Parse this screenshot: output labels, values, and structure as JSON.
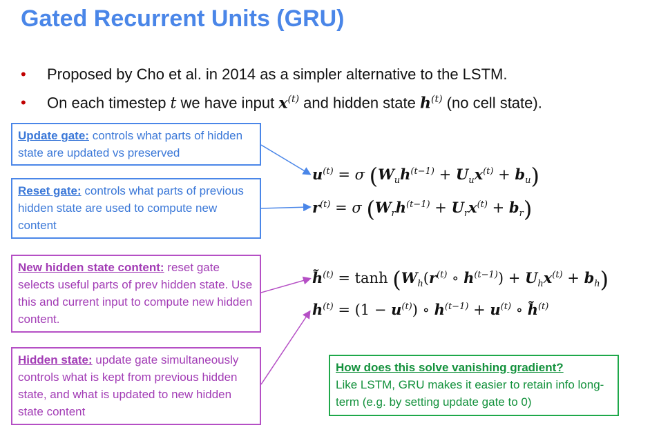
{
  "title": "Gated Recurrent Units (GRU)",
  "bullets": {
    "b1": "Proposed by Cho et al. in 2014 as a simpler alternative to the LSTM.",
    "b2_pre": "On each timestep ",
    "b2_t": "t",
    "b2_mid": " we have input ",
    "b2_mid2": " and hidden state ",
    "b2_post": " (no cell state)."
  },
  "boxes": {
    "update": {
      "heading": "Update gate:",
      "body": " controls what parts of hidden state are updated vs preserved"
    },
    "reset": {
      "heading": "Reset gate:",
      "body": " controls what parts of previous hidden state are used to compute new content"
    },
    "newcontent": {
      "heading": "New hidden state content:",
      "body": " reset gate selects useful parts of prev hidden state. Use this and current input to compute new hidden content."
    },
    "hidden": {
      "heading": "Hidden state:",
      "body": " update gate simultaneously controls what is kept from previous hidden state, and what is updated to new hidden state content"
    },
    "vanishing": {
      "heading": "How does this solve vanishing gradient?",
      "body": "Like LSTM, GRU makes it easier to retain info long-term (e.g. by setting update gate to 0)"
    }
  },
  "colors": {
    "title": "#4a86e8",
    "blue": "#4a86e8",
    "purple": "#b54fc5",
    "green": "#1ea84a",
    "bullet": "#c00000"
  }
}
